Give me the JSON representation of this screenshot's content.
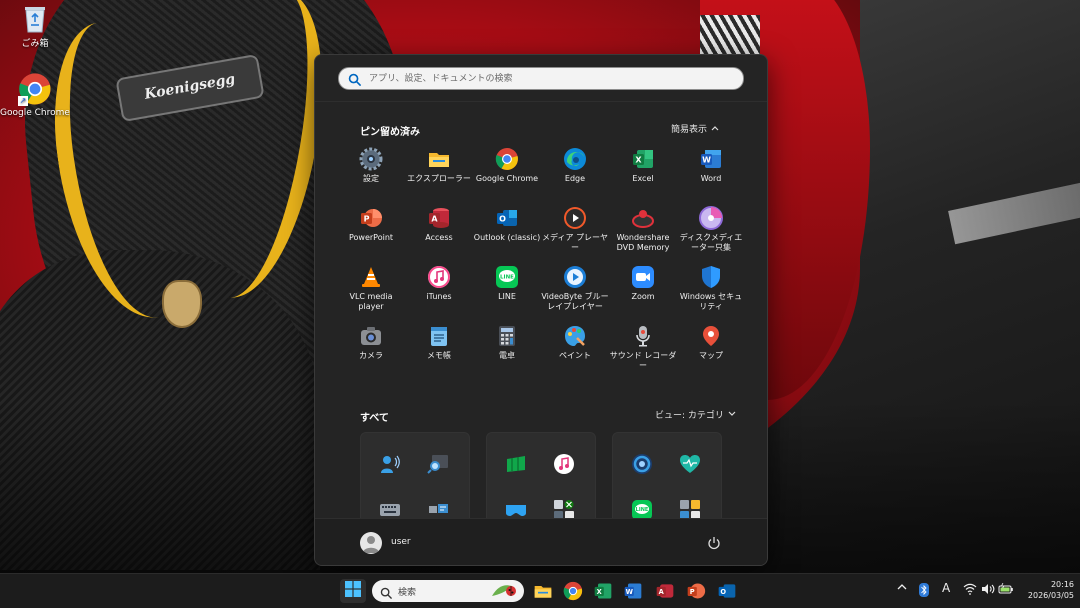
{
  "desktop": {
    "icons": [
      {
        "label": "ごみ箱",
        "icon": "recycle-bin-icon"
      },
      {
        "label": "Google Chrome",
        "icon": "chrome-icon"
      }
    ],
    "wallpaper_badge": "Koenigsegg"
  },
  "start_menu": {
    "search_placeholder": "アプリ、設定、ドキュメントの検索",
    "pinned": {
      "title": "ピン留め済み",
      "toggle_label": "簡易表示",
      "apps": [
        {
          "label": "設定",
          "icon": "settings-gear-icon"
        },
        {
          "label": "エクスプローラー",
          "icon": "file-explorer-icon"
        },
        {
          "label": "Google Chrome",
          "icon": "chrome-icon"
        },
        {
          "label": "Edge",
          "icon": "edge-icon"
        },
        {
          "label": "Excel",
          "icon": "excel-icon"
        },
        {
          "label": "Word",
          "icon": "word-icon"
        },
        {
          "label": "PowerPoint",
          "icon": "powerpoint-icon"
        },
        {
          "label": "Access",
          "icon": "access-icon"
        },
        {
          "label": "Outlook (classic)",
          "icon": "outlook-icon"
        },
        {
          "label": "メディア プレーヤー",
          "icon": "media-player-icon"
        },
        {
          "label": "Wondershare DVD Memory",
          "icon": "dvd-memory-icon"
        },
        {
          "label": "ディスクメディエーター只集",
          "icon": "disc-icon"
        },
        {
          "label": "VLC media player",
          "icon": "vlc-cone-icon"
        },
        {
          "label": "iTunes",
          "icon": "itunes-icon"
        },
        {
          "label": "LINE",
          "icon": "line-icon"
        },
        {
          "label": "VideoByte ブルーレイプレイヤー",
          "icon": "videobyte-icon"
        },
        {
          "label": "Zoom",
          "icon": "zoom-icon"
        },
        {
          "label": "Windows セキュリティ",
          "icon": "security-shield-icon"
        },
        {
          "label": "カメラ",
          "icon": "camera-icon"
        },
        {
          "label": "メモ帳",
          "icon": "notepad-icon"
        },
        {
          "label": "電卓",
          "icon": "calculator-icon"
        },
        {
          "label": "ペイント",
          "icon": "paint-icon"
        },
        {
          "label": "サウンド レコーダー",
          "icon": "sound-recorder-icon"
        },
        {
          "label": "マップ",
          "icon": "maps-icon"
        }
      ]
    },
    "all": {
      "title": "すべて",
      "view_label": "ビュー: カテゴリ"
    },
    "user": {
      "name": "user"
    }
  },
  "taskbar": {
    "search_label": "検索",
    "apps": [
      "file-explorer-icon",
      "chrome-icon",
      "excel-icon",
      "word-icon",
      "access-icon",
      "powerpoint-icon",
      "outlook-icon"
    ],
    "tray": {
      "ime_label": "A"
    },
    "clock": {
      "time": "20:16",
      "date": "2026/03/05"
    }
  },
  "colors": {
    "accent": "#4cc2ff",
    "start_bg": "#242424",
    "taskbar_bg": "#1c1c1c"
  }
}
